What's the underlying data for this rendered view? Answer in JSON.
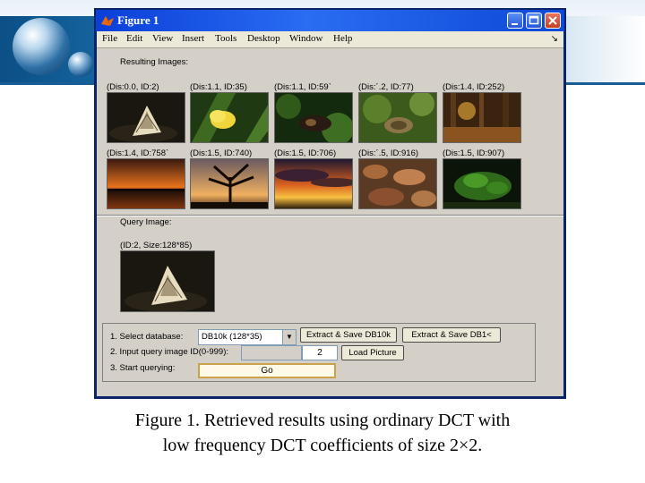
{
  "window": {
    "title": "Figure 1"
  },
  "menu": [
    "File",
    "Edit",
    "View",
    "Insert",
    "Tools",
    "Desktop",
    "Window",
    "Help"
  ],
  "menu_arrow": "↘",
  "results": {
    "heading": "Resulting Images:",
    "row1": [
      {
        "label": "(Dis:0.0, ID:2)",
        "scene": "moth-on-dark"
      },
      {
        "label": "(Dis:1.1, ID:35)",
        "scene": "yellow-butterfly-on-leaf"
      },
      {
        "label": "(Dis:1.1, ID:59`",
        "scene": "dark-butterfly-foliage"
      },
      {
        "label": "(Dis:´.2, ID:77)",
        "scene": "moth-on-leaves"
      },
      {
        "label": "(Dis:1.4, ID:252)",
        "scene": "autumn-forest"
      }
    ],
    "row2": [
      {
        "label": "(Dis:1.4, ID:758`",
        "scene": "sunset-lake"
      },
      {
        "label": "(Dis:1.5, ID:740)",
        "scene": "tree-silhouette-sunset"
      },
      {
        "label": "(Dis:1.5, ID:706)",
        "scene": "cloudy-sunset"
      },
      {
        "label": "(Dis:´.5, ID:916)",
        "scene": "dry-leaves"
      },
      {
        "label": "(Dis:1.5, ID:907)",
        "scene": "green-plant-dark"
      }
    ]
  },
  "query": {
    "heading": "Query Image:",
    "info": "(ID:2, Size:128*85)",
    "scene": "moth-on-dark"
  },
  "controls": {
    "step1_label": "1. Select database:",
    "db_value": "DB10k (128*35)",
    "db_arrow": "▼",
    "extract_btn_1": "Extract & Save DB10k",
    "extract_btn_2": "Extract & Save DB1<",
    "step2_label": "2. Input query image ID(0-999):",
    "query_id": "2",
    "load_btn": "Load Picture",
    "step3_label": "3. Start querying:",
    "go_btn": "Go"
  },
  "caption": {
    "line1": "Figure 1.  Retrieved results using ordinary DCT with",
    "line2": "low frequency DCT coefficients of size 2×2."
  },
  "colors": {
    "window_frame": "#0a246a",
    "titlebar": "#2a6cf2",
    "client_bg": "#d4d0c8"
  },
  "icons": {
    "title_icon": "matlab-logo-icon",
    "minimize": "minimize-icon",
    "maximize": "maximize-icon",
    "close": "close-icon"
  }
}
